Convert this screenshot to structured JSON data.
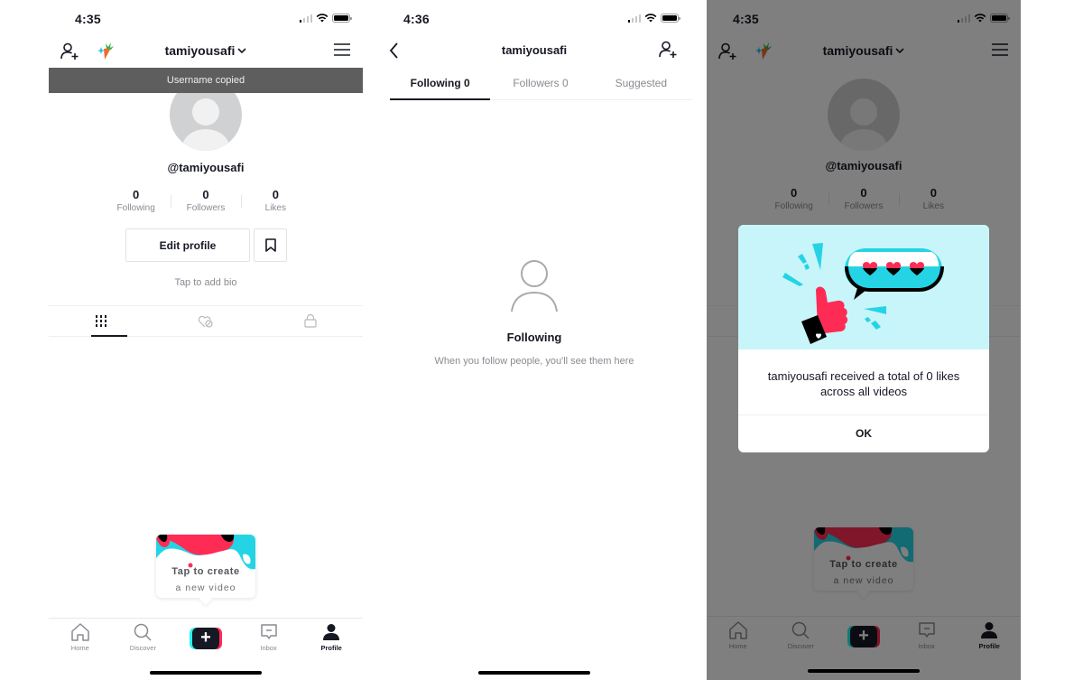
{
  "screens": [
    {
      "status_time": "4:35",
      "username": "tamiyousafi",
      "toast": "Username copied",
      "handle": "@tamiyousafi",
      "stats": [
        {
          "value": "0",
          "label": "Following"
        },
        {
          "value": "0",
          "label": "Followers"
        },
        {
          "value": "0",
          "label": "Likes"
        }
      ],
      "edit_profile_label": "Edit profile",
      "bio_placeholder": "Tap to add bio",
      "profile_tabs": [
        "videos-grid-icon",
        "liked-hidden-icon",
        "private-lock-icon"
      ],
      "create_tip": {
        "line1": "Tap to create",
        "line2": "a new video"
      }
    },
    {
      "status_time": "4:36",
      "title": "tamiyousafi",
      "tabs": [
        {
          "label": "Following 0",
          "active": true
        },
        {
          "label": "Followers 0",
          "active": false
        },
        {
          "label": "Suggested",
          "active": false
        }
      ],
      "empty_title": "Following",
      "empty_subtitle": "When you follow people, you'll see them here"
    },
    {
      "status_time": "4:35",
      "username": "tamiyousafi",
      "handle": "@tamiyousafi",
      "stats": [
        {
          "value": "0",
          "label": "Following"
        },
        {
          "value": "0",
          "label": "Followers"
        },
        {
          "value": "0",
          "label": "Likes"
        }
      ],
      "create_tip": {
        "line1": "Tap to create",
        "line2": "a new video"
      },
      "modal": {
        "message": "tamiyousafi received a total of 0 likes across all videos",
        "ok_label": "OK"
      }
    }
  ],
  "tabbar": {
    "items": [
      {
        "label": "Home",
        "icon": "home-icon"
      },
      {
        "label": "Discover",
        "icon": "search-icon"
      },
      {
        "label": "",
        "icon": "create-plus-icon"
      },
      {
        "label": "Inbox",
        "icon": "inbox-icon"
      },
      {
        "label": "Profile",
        "icon": "profile-icon",
        "active": true
      }
    ]
  },
  "colors": {
    "brand_cyan": "#25f4ee",
    "brand_red": "#fe2c55",
    "text_primary": "#161823",
    "text_secondary": "#8a8b91",
    "toast_bg": "#5e5e5e",
    "modal_illustration_bg": "#c7f5fa"
  }
}
